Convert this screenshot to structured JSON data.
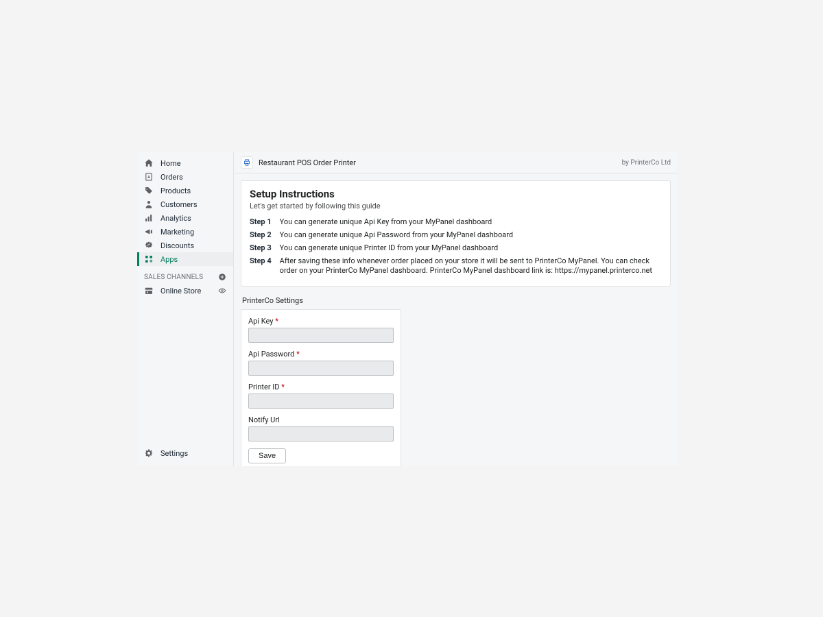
{
  "sidebar": {
    "items": [
      {
        "label": "Home"
      },
      {
        "label": "Orders"
      },
      {
        "label": "Products"
      },
      {
        "label": "Customers"
      },
      {
        "label": "Analytics"
      },
      {
        "label": "Marketing"
      },
      {
        "label": "Discounts"
      },
      {
        "label": "Apps"
      }
    ],
    "channels_header": "SALES CHANNELS",
    "channels": [
      {
        "label": "Online Store"
      }
    ],
    "settings_label": "Settings"
  },
  "topbar": {
    "title": "Restaurant POS Order Printer",
    "vendor": "by PrinterCo Ltd"
  },
  "instructions": {
    "title": "Setup Instructions",
    "subtitle": "Let's get started by following this guide",
    "steps": [
      {
        "label": "Step 1",
        "text": "You can generate unique Api Key from your MyPanel dashboard"
      },
      {
        "label": "Step 2",
        "text": "You can generate unique Api Password from your MyPanel dashboard"
      },
      {
        "label": "Step 3",
        "text": "You can generate unique Printer ID from your MyPanel dashboard"
      },
      {
        "label": "Step 4",
        "text": "After saving these info whenever order placed on your store it will be sent to PrinterCo MyPanel. You can check order on your PrinterCo MyPanel dashboard. PrinterCo MyPanel dashboard link is: https://mypanel.printerco.net"
      }
    ]
  },
  "settings": {
    "title": "PrinterCo Settings",
    "fields": {
      "api_key": {
        "label": "Api Key",
        "required": true,
        "value": ""
      },
      "api_password": {
        "label": "Api Password",
        "required": true,
        "value": ""
      },
      "printer_id": {
        "label": "Printer ID",
        "required": true,
        "value": ""
      },
      "notify_url": {
        "label": "Notify Url",
        "required": false,
        "value": ""
      }
    },
    "save_label": "Save"
  }
}
